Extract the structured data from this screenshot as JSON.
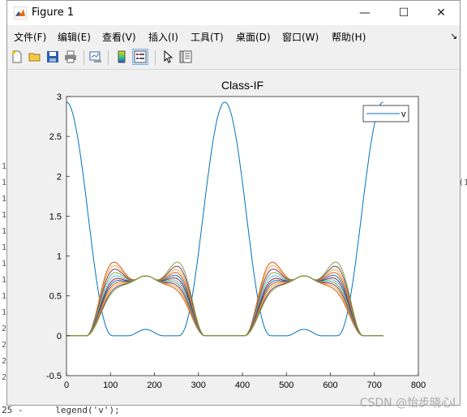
{
  "window": {
    "title": "Figure 1",
    "controls": {
      "minimize": "—",
      "maximize": "☐",
      "close": "✕"
    }
  },
  "menu": [
    {
      "label": "文件(F)"
    },
    {
      "label": "编辑(E)"
    },
    {
      "label": "查看(V)"
    },
    {
      "label": "插入(I)"
    },
    {
      "label": "工具(T)"
    },
    {
      "label": "桌面(D)"
    },
    {
      "label": "窗口(W)"
    },
    {
      "label": "帮助(H)"
    }
  ],
  "toolbar": {
    "icons": [
      "new-figure-icon",
      "open-file-icon",
      "save-icon",
      "print-icon",
      "link-plot-icon",
      "colorbar-icon",
      "legend-icon",
      "pointer-icon",
      "property-inspector-icon"
    ]
  },
  "background": {
    "line_numbers": [
      "1",
      "1",
      "1",
      "1",
      "1",
      "1",
      "1",
      "1",
      "1",
      "1",
      "2",
      "2",
      "2",
      "2"
    ],
    "right_fragment": "(1",
    "bottom_line": "25 -      legend('v');"
  },
  "watermark": "CSDN @怡步晓心l",
  "chart_data": {
    "type": "line",
    "title": "Class-IF",
    "xlabel": "",
    "ylabel": "",
    "xlim": [
      0,
      800
    ],
    "ylim": [
      -0.5,
      3
    ],
    "x_ticks": [
      0,
      100,
      200,
      300,
      400,
      500,
      600,
      700,
      800
    ],
    "y_ticks": [
      -0.5,
      0,
      0.5,
      1,
      1.5,
      2,
      2.5,
      3
    ],
    "x_tick_labels": [
      "0",
      "100",
      "200",
      "300",
      "400",
      "500",
      "600",
      "700",
      "800"
    ],
    "y_tick_labels": [
      "-0.5",
      "0",
      "0.5",
      "1",
      "1.5",
      "2",
      "2.5",
      "3"
    ],
    "grid": false,
    "legend": {
      "position": "top-right",
      "entries": [
        "v"
      ]
    },
    "colors": [
      "#0072BD",
      "#D95319",
      "#EDB120",
      "#7E2F8E",
      "#77AC30",
      "#4DBEEE",
      "#A2142F"
    ],
    "x": [
      0,
      720
    ],
    "series": [
      {
        "name": "v",
        "peak": 2.93,
        "valley_bump": 0.08
      },
      {
        "family": "current",
        "count": 11,
        "crossing": {
          "x": 180,
          "y": 0.75
        },
        "peaks_first": [
          1.24,
          1.18,
          1.12,
          1.06,
          1.0,
          0.95,
          0.91,
          0.87,
          0.83,
          0.79,
          0.76
        ],
        "peaks_second": [
          0.76,
          0.8,
          0.84,
          0.88,
          0.92,
          0.96,
          1.01,
          1.06,
          1.11,
          1.17,
          1.24
        ]
      }
    ]
  }
}
